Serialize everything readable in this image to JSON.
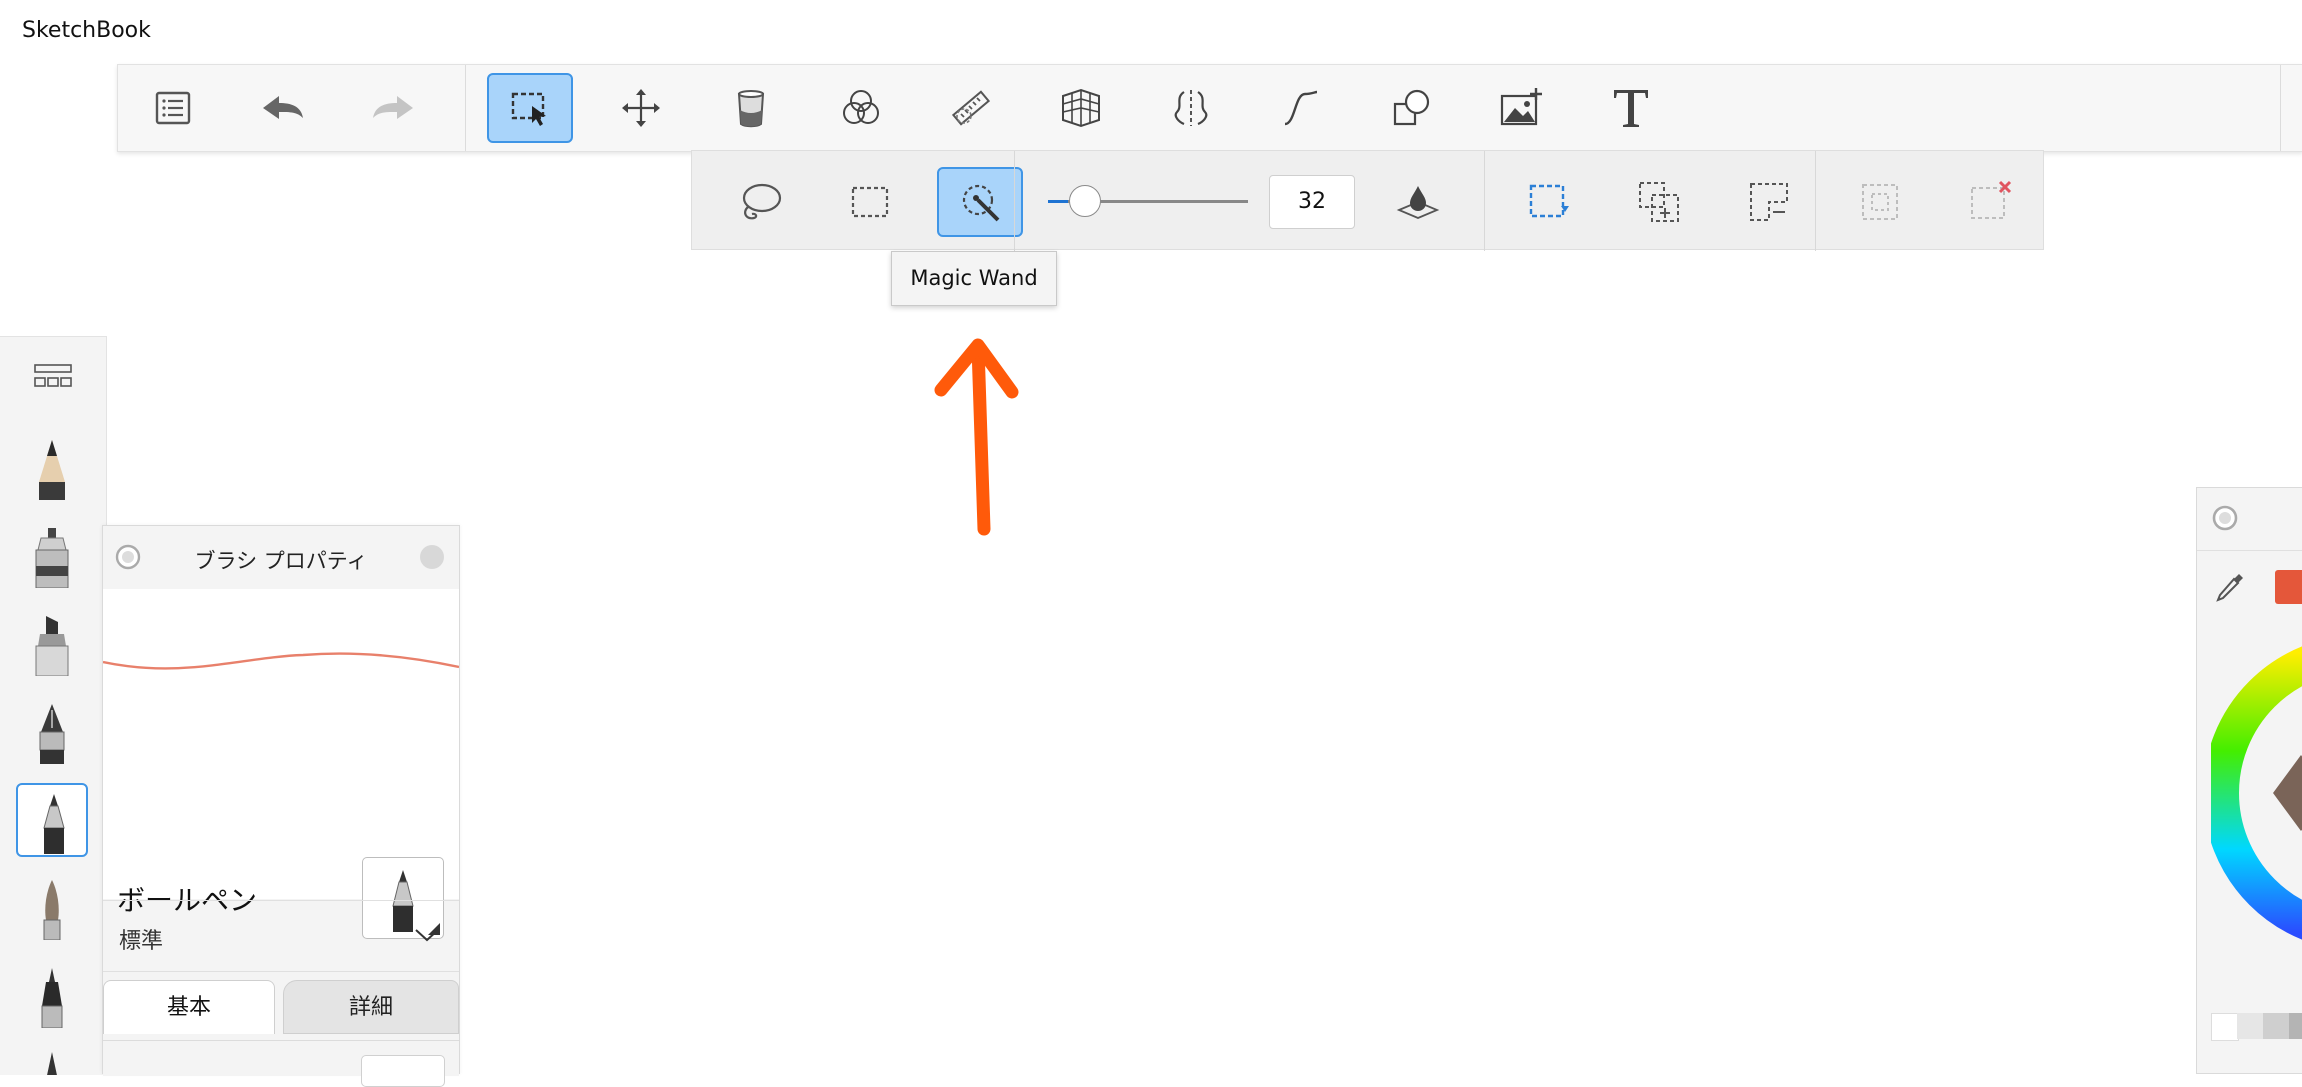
{
  "app": {
    "title": "SketchBook"
  },
  "main_toolbar": {
    "tools": [
      {
        "name": "list-icon"
      },
      {
        "name": "undo-icon"
      },
      {
        "name": "redo-icon"
      },
      {
        "name": "selection-tool-icon",
        "active": true
      },
      {
        "name": "transform-move-icon"
      },
      {
        "name": "fill-bucket-icon"
      },
      {
        "name": "blend-circles-icon"
      },
      {
        "name": "ruler-icon"
      },
      {
        "name": "perspective-grid-icon"
      },
      {
        "name": "symmetry-icon"
      },
      {
        "name": "curve-stroke-icon"
      },
      {
        "name": "shapes-icon"
      },
      {
        "name": "add-image-icon"
      },
      {
        "name": "text-tool-icon"
      }
    ]
  },
  "selection_toolbar": {
    "tools": [
      {
        "name": "lasso-icon"
      },
      {
        "name": "rectangle-select-icon"
      },
      {
        "name": "magic-wand-icon",
        "active": true
      }
    ],
    "tolerance_value": "32",
    "tolerance_fraction": 0.1,
    "actions": [
      {
        "name": "opacity-drop-icon"
      },
      {
        "name": "new-selection-icon"
      },
      {
        "name": "add-to-selection-icon"
      },
      {
        "name": "subtract-selection-icon"
      },
      {
        "name": "invert-selection-icon"
      },
      {
        "name": "clear-selection-icon"
      }
    ]
  },
  "tooltip": {
    "text": "Magic Wand"
  },
  "brush_strip": {
    "header_icon": "brush-library-grid-icon",
    "brushes": [
      {
        "name": "pencil-icon"
      },
      {
        "name": "inking-pen-icon"
      },
      {
        "name": "marker-icon"
      },
      {
        "name": "fountain-pen-icon"
      },
      {
        "name": "ballpoint-pen-icon",
        "selected": true
      },
      {
        "name": "soft-brush-icon"
      },
      {
        "name": "technical-pen-icon"
      },
      {
        "name": "brush-tip-icon"
      }
    ]
  },
  "brush_panel": {
    "title": "ブラシ プロパティ",
    "brush_name": "ボールペン",
    "preset": "標準",
    "tabs": [
      {
        "label": "基本",
        "active": true
      },
      {
        "label": "詳細",
        "active": false
      }
    ],
    "stroke_color": "#e8806b"
  },
  "color_panel": {
    "current_color": "#e4573a"
  },
  "colors": {
    "accent": "#3f95e6",
    "active_bg": "#a9d4fa",
    "annotation": "#ff5a0a",
    "slider_fill": "#1e73d2"
  }
}
